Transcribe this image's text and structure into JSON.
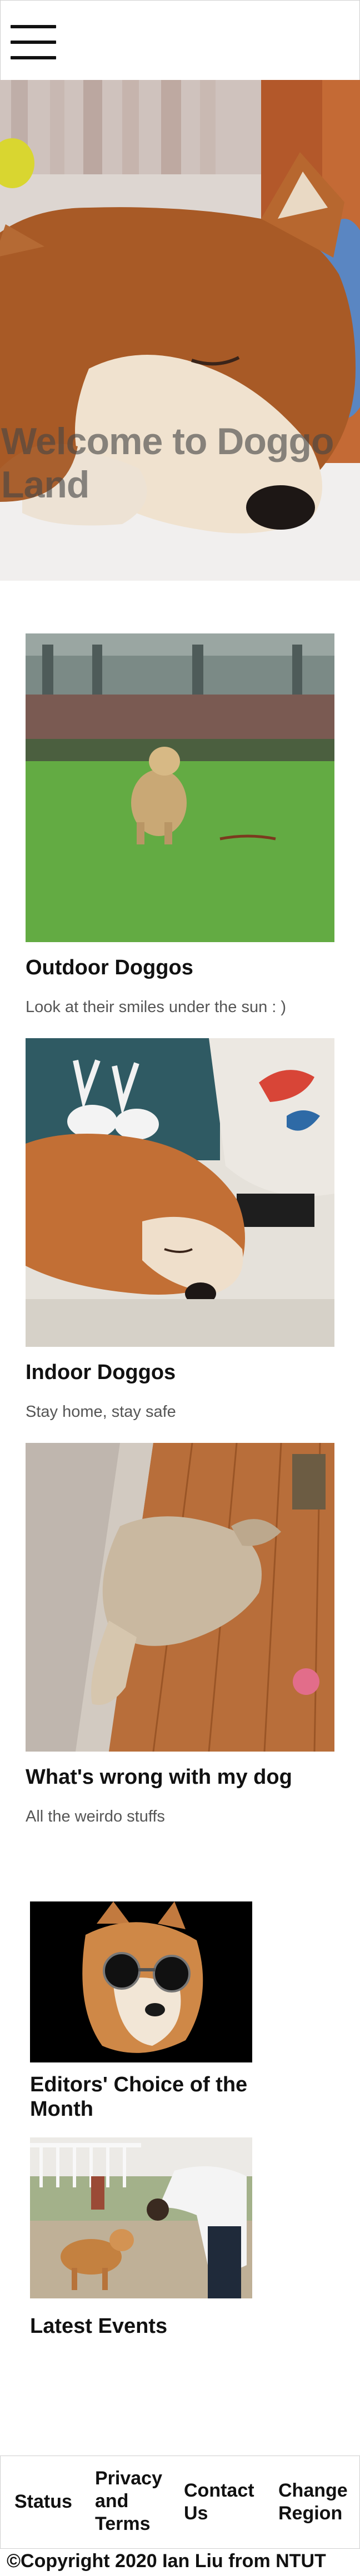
{
  "header": {
    "menu_icon": "hamburger-menu-icon"
  },
  "hero": {
    "title": "Welcome to Doggo Land"
  },
  "cards": [
    {
      "title": "Outdoor Doggos",
      "desc": "Look at their smiles under the sun : )"
    },
    {
      "title": "Indoor Doggos",
      "desc": "Stay home, stay safe"
    },
    {
      "title": "What's wrong with my dog",
      "desc": "All the weirdo stuffs"
    }
  ],
  "featured": [
    {
      "title": "Editors' Choice of the Month"
    },
    {
      "title": "Latest Events"
    }
  ],
  "footer": {
    "links": [
      "Status",
      "Privacy and Terms",
      "Contact Us",
      "Change Region"
    ],
    "copyright": "©Copyright 2020 Ian Liu from NTUT"
  }
}
